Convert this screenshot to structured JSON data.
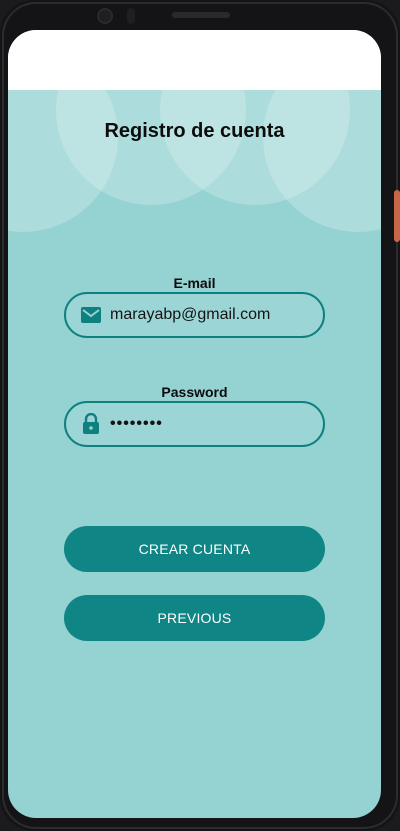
{
  "page": {
    "title": "Registro de cuenta"
  },
  "form": {
    "email": {
      "label": "E-mail",
      "value": "marayabp@gmail.com",
      "icon": "envelope-icon"
    },
    "password": {
      "label": "Password",
      "value": "••••••••",
      "icon": "lock-icon"
    }
  },
  "actions": {
    "create_label": "CREAR CUENTA",
    "previous_label": "PREVIOUS"
  },
  "colors": {
    "background": "#95d2d2",
    "accent": "#0f8585",
    "appbar": "#ffffff"
  }
}
